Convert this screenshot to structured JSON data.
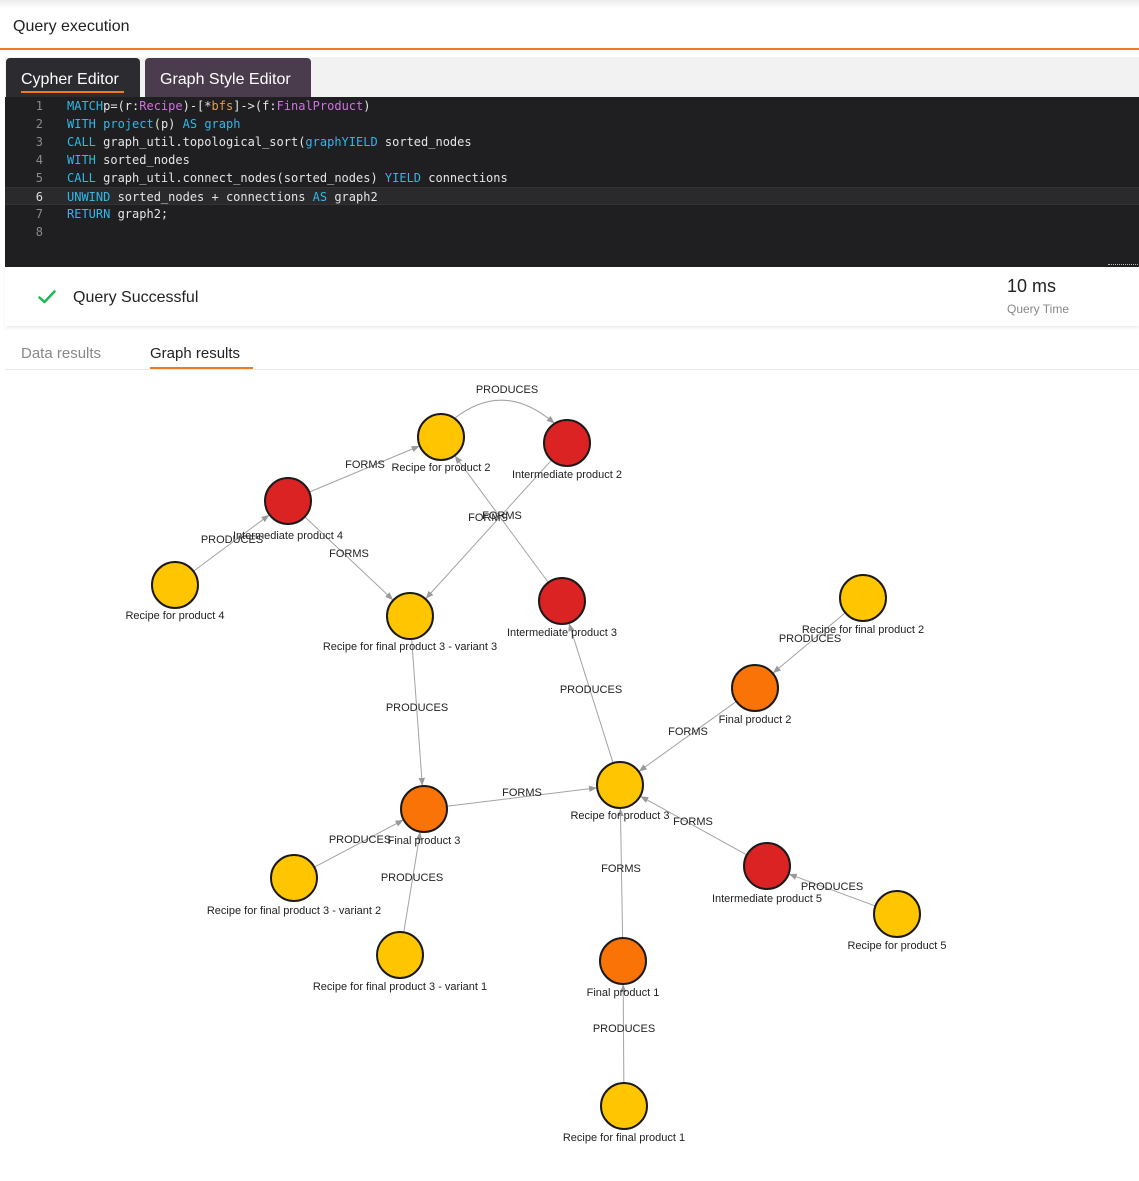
{
  "header": {
    "title": "Query execution"
  },
  "editor": {
    "tabs": [
      {
        "label": "Cypher Editor",
        "active": true
      },
      {
        "label": "Graph Style Editor",
        "active": false
      }
    ],
    "current_line": 6,
    "lines": [
      {
        "num": "1",
        "tokens": [
          [
            "kw",
            "MATCH"
          ],
          [
            "",
            "p=(r:"
          ],
          [
            "lbl",
            "Recipe"
          ],
          [
            "",
            ")-[*"
          ],
          [
            "var",
            "bfs"
          ],
          [
            "",
            "]->(f:"
          ],
          [
            "lbl",
            "FinalProduct"
          ],
          [
            "",
            ")"
          ]
        ]
      },
      {
        "num": "2",
        "tokens": [
          [
            "kw",
            "WITH"
          ],
          [
            "",
            " "
          ],
          [
            "fn",
            "project"
          ],
          [
            "",
            "(p) "
          ],
          [
            "kw",
            "AS"
          ],
          [
            "",
            " "
          ],
          [
            "kw",
            "graph"
          ]
        ]
      },
      {
        "num": "3",
        "tokens": [
          [
            "kw",
            "CALL"
          ],
          [
            "",
            " graph_util.topological_sort("
          ],
          [
            "kw",
            "graph"
          ],
          [
            ") "
          ],
          [
            "kw",
            "YIELD"
          ],
          [
            "",
            " sorted_nodes"
          ]
        ]
      },
      {
        "num": "4",
        "tokens": [
          [
            "kw",
            "WITH"
          ],
          [
            "",
            " sorted_nodes"
          ]
        ]
      },
      {
        "num": "5",
        "tokens": [
          [
            "kw",
            "CALL"
          ],
          [
            "",
            " graph_util.connect_nodes(sorted_nodes) "
          ],
          [
            "kw",
            "YIELD"
          ],
          [
            "",
            " connections"
          ]
        ]
      },
      {
        "num": "6",
        "tokens": [
          [
            "kw",
            "UNWIND"
          ],
          [
            "",
            " sorted_nodes + connections "
          ],
          [
            "kw",
            "AS"
          ],
          [
            "",
            " graph2"
          ]
        ]
      },
      {
        "num": "7",
        "tokens": [
          [
            "kw",
            "RETURN"
          ],
          [
            "",
            " graph2;"
          ]
        ]
      },
      {
        "num": "8",
        "tokens": []
      }
    ]
  },
  "status": {
    "message": "Query Successful",
    "query_time": "10 ms",
    "query_time_label": "Query Time"
  },
  "results": {
    "tabs": [
      {
        "label": "Data results",
        "active": false
      },
      {
        "label": "Graph results",
        "active": true
      }
    ]
  },
  "colors": {
    "accent": "#f07a1f",
    "recipe": "#ffc600",
    "intermediate": "#dc2323",
    "final": "#f97306",
    "success": "#1db954"
  },
  "graph": {
    "nodes": [
      {
        "id": "r2",
        "label": "Recipe for product 2",
        "kind": "recipe"
      },
      {
        "id": "i2",
        "label": "Intermediate product 2",
        "kind": "intermediate"
      },
      {
        "id": "i4",
        "label": "Intermediate product 4",
        "kind": "intermediate"
      },
      {
        "id": "r4",
        "label": "Recipe for product 4",
        "kind": "recipe"
      },
      {
        "id": "rf3v3",
        "label": "Recipe for final product 3 - variant 3",
        "kind": "recipe"
      },
      {
        "id": "i3",
        "label": "Intermediate product 3",
        "kind": "intermediate"
      },
      {
        "id": "rf2",
        "label": "Recipe for final product 2",
        "kind": "recipe"
      },
      {
        "id": "f2",
        "label": "Final product 2",
        "kind": "final"
      },
      {
        "id": "r3",
        "label": "Recipe for product 3",
        "kind": "recipe"
      },
      {
        "id": "f3",
        "label": "Final product 3",
        "kind": "final"
      },
      {
        "id": "rf3v2",
        "label": "Recipe for final product 3 - variant 2",
        "kind": "recipe"
      },
      {
        "id": "rf3v1",
        "label": "Recipe for final product 3 - variant 1",
        "kind": "recipe"
      },
      {
        "id": "i5",
        "label": "Intermediate product 5",
        "kind": "intermediate"
      },
      {
        "id": "r5",
        "label": "Recipe for product 5",
        "kind": "recipe"
      },
      {
        "id": "f1",
        "label": "Final product 1",
        "kind": "final"
      },
      {
        "id": "rf1",
        "label": "Recipe for final product 1",
        "kind": "recipe"
      }
    ],
    "edges": [
      {
        "from": "r2",
        "to": "i2",
        "label": "PRODUCES",
        "curved": true
      },
      {
        "from": "i4",
        "to": "r2",
        "label": "FORMS"
      },
      {
        "from": "i2",
        "to": "rf3v3",
        "label": "FORMS"
      },
      {
        "from": "i3",
        "to": "r2",
        "label": "FORMS"
      },
      {
        "from": "r4",
        "to": "i4",
        "label": "PRODUCES"
      },
      {
        "from": "i4",
        "to": "rf3v3",
        "label": "FORMS"
      },
      {
        "from": "rf3v3",
        "to": "f3",
        "label": "PRODUCES"
      },
      {
        "from": "r3",
        "to": "i3",
        "label": "PRODUCES"
      },
      {
        "from": "rf2",
        "to": "f2",
        "label": "PRODUCES"
      },
      {
        "from": "f2",
        "to": "r3",
        "label": "FORMS"
      },
      {
        "from": "f3",
        "to": "r3",
        "label": "FORMS"
      },
      {
        "from": "rf3v2",
        "to": "f3",
        "label": "PRODUCES"
      },
      {
        "from": "rf3v1",
        "to": "f3",
        "label": "PRODUCES"
      },
      {
        "from": "i5",
        "to": "r3",
        "label": "FORMS"
      },
      {
        "from": "r5",
        "to": "i5",
        "label": "PRODUCES"
      },
      {
        "from": "f1",
        "to": "r3",
        "label": "FORMS"
      },
      {
        "from": "rf1",
        "to": "f1",
        "label": "PRODUCES"
      }
    ]
  }
}
